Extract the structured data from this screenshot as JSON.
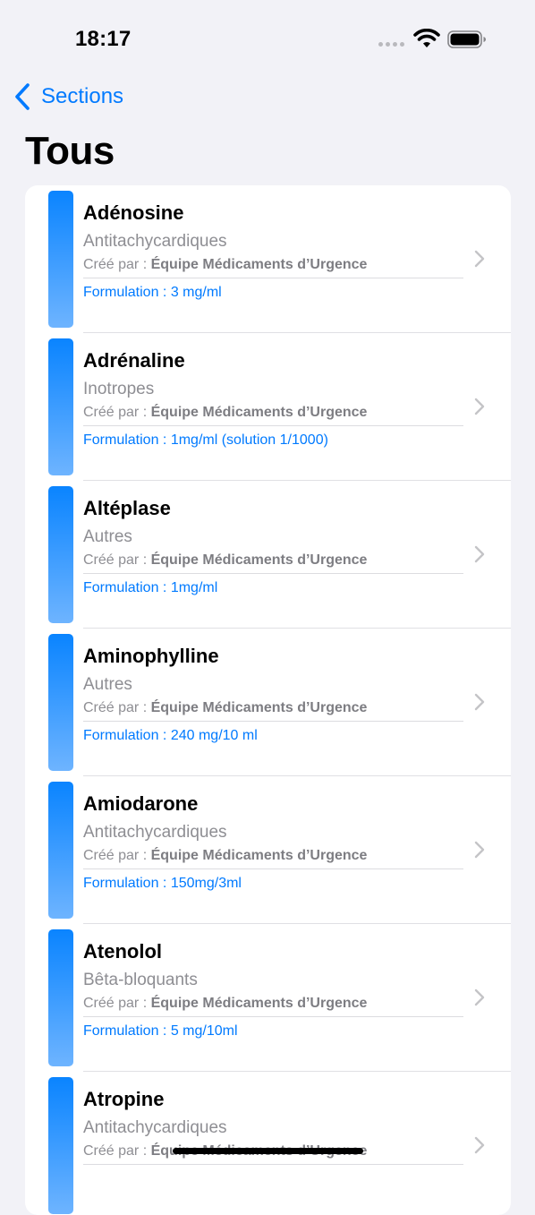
{
  "status_bar": {
    "time": "18:17"
  },
  "nav": {
    "back_label": "Sections"
  },
  "page": {
    "title": "Tous"
  },
  "colors": {
    "accent": "#007aff",
    "bar_top": "#0a84ff",
    "bar_bottom": "#6eb4ff",
    "secondary_text": "#8e8e93",
    "background": "#f2f2f7"
  },
  "list": {
    "author_prefix": "Créé par :",
    "formulation_prefix": "Formulation :",
    "items": [
      {
        "name": "Adénosine",
        "category": "Antitachycardiques",
        "author": "Équipe Médicaments d’Urgence",
        "formulation": "3 mg/ml"
      },
      {
        "name": "Adrénaline",
        "category": "Inotropes",
        "author": "Équipe Médicaments d’Urgence",
        "formulation": "1mg/ml (solution 1/1000)"
      },
      {
        "name": "Altéplase",
        "category": "Autres",
        "author": "Équipe Médicaments d’Urgence",
        "formulation": "1mg/ml"
      },
      {
        "name": "Aminophylline",
        "category": "Autres",
        "author": "Équipe Médicaments d’Urgence",
        "formulation": "240 mg/10 ml"
      },
      {
        "name": "Amiodarone",
        "category": "Antitachycardiques",
        "author": "Équipe Médicaments d’Urgence",
        "formulation": "150mg/3ml"
      },
      {
        "name": "Atenolol",
        "category": "Bêta-bloquants",
        "author": "Équipe Médicaments d’Urgence",
        "formulation": "5 mg/10ml"
      },
      {
        "name": "Atropine",
        "category": "Antitachycardiques",
        "author": "Équipe Médicaments d’Urgence",
        "formulation": ""
      }
    ]
  }
}
